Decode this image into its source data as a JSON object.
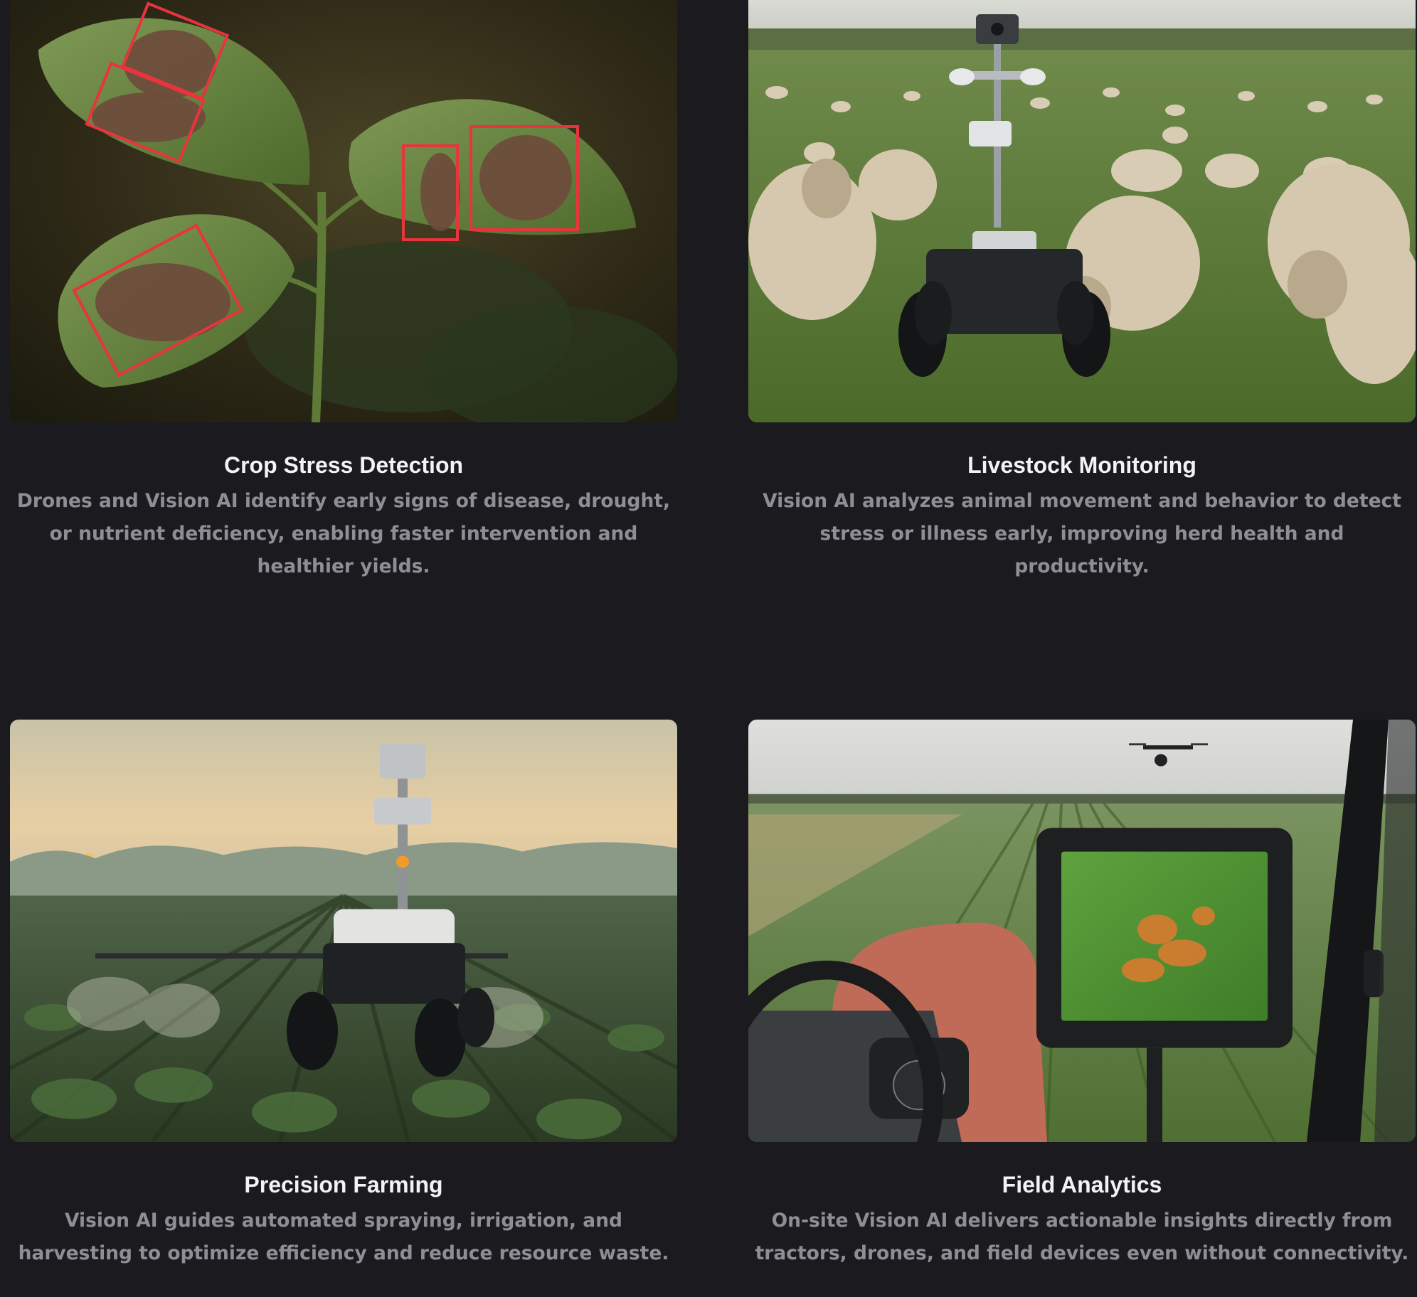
{
  "cards": [
    {
      "title": "Crop Stress Detection",
      "description": "Drones and Vision AI identify early signs of disease, drought, or nutrient deficiency, enabling faster intervention and healthier yields."
    },
    {
      "title": "Livestock Monitoring",
      "description": "Vision AI analyzes animal movement and behavior to detect stress or illness early, improving herd health and productivity."
    },
    {
      "title": "Precision Farming",
      "description": "Vision AI guides automated spraying, irrigation, and harvesting to optimize efficiency and reduce resource waste."
    },
    {
      "title": "Field Analytics",
      "description": "On-site Vision AI delivers actionable insights directly from tractors, drones, and field devices even without connectivity."
    }
  ],
  "colors": {
    "background": "#1b1b1f",
    "title": "#f3f3f5",
    "description": "#8e8e94",
    "detection_box": "#e8343c"
  }
}
